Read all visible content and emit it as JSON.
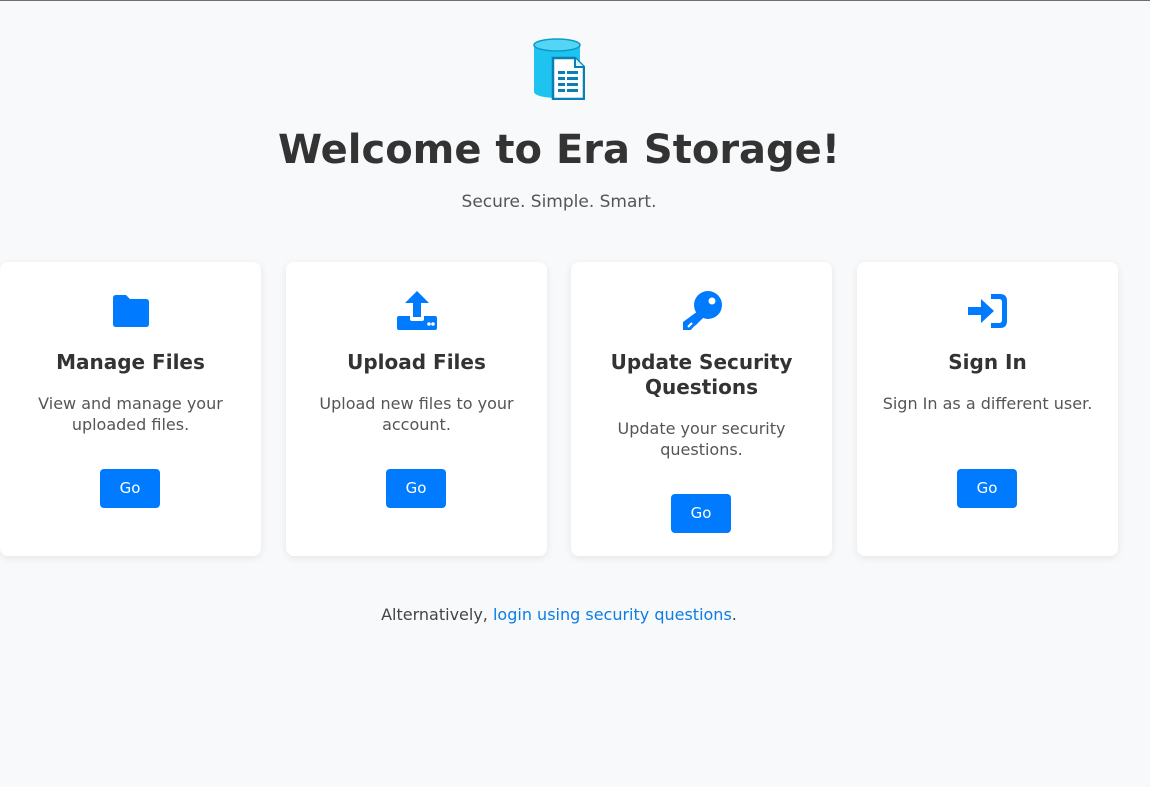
{
  "colors": {
    "accent": "#007bff",
    "logo_cyan": "#1ec4ef",
    "background": "#f8f9fa",
    "card": "#ffffff"
  },
  "header": {
    "logo_icon": "database-document-icon",
    "title": "Welcome to Era Storage!",
    "tagline": "Secure. Simple. Smart."
  },
  "cards": [
    {
      "icon": "folder-icon",
      "title": "Manage Files",
      "description": "View and manage your uploaded files.",
      "button_label": "Go"
    },
    {
      "icon": "upload-icon",
      "title": "Upload Files",
      "description": "Upload new files to your account.",
      "button_label": "Go"
    },
    {
      "icon": "key-icon",
      "title": "Update Security Questions",
      "description": "Update your security questions.",
      "button_label": "Go"
    },
    {
      "icon": "sign-in-icon",
      "title": "Sign In",
      "description": "Sign In as a different user.",
      "button_label": "Go"
    }
  ],
  "footer": {
    "prefix": "Alternatively, ",
    "link_text": "login using security questions",
    "suffix": "."
  }
}
